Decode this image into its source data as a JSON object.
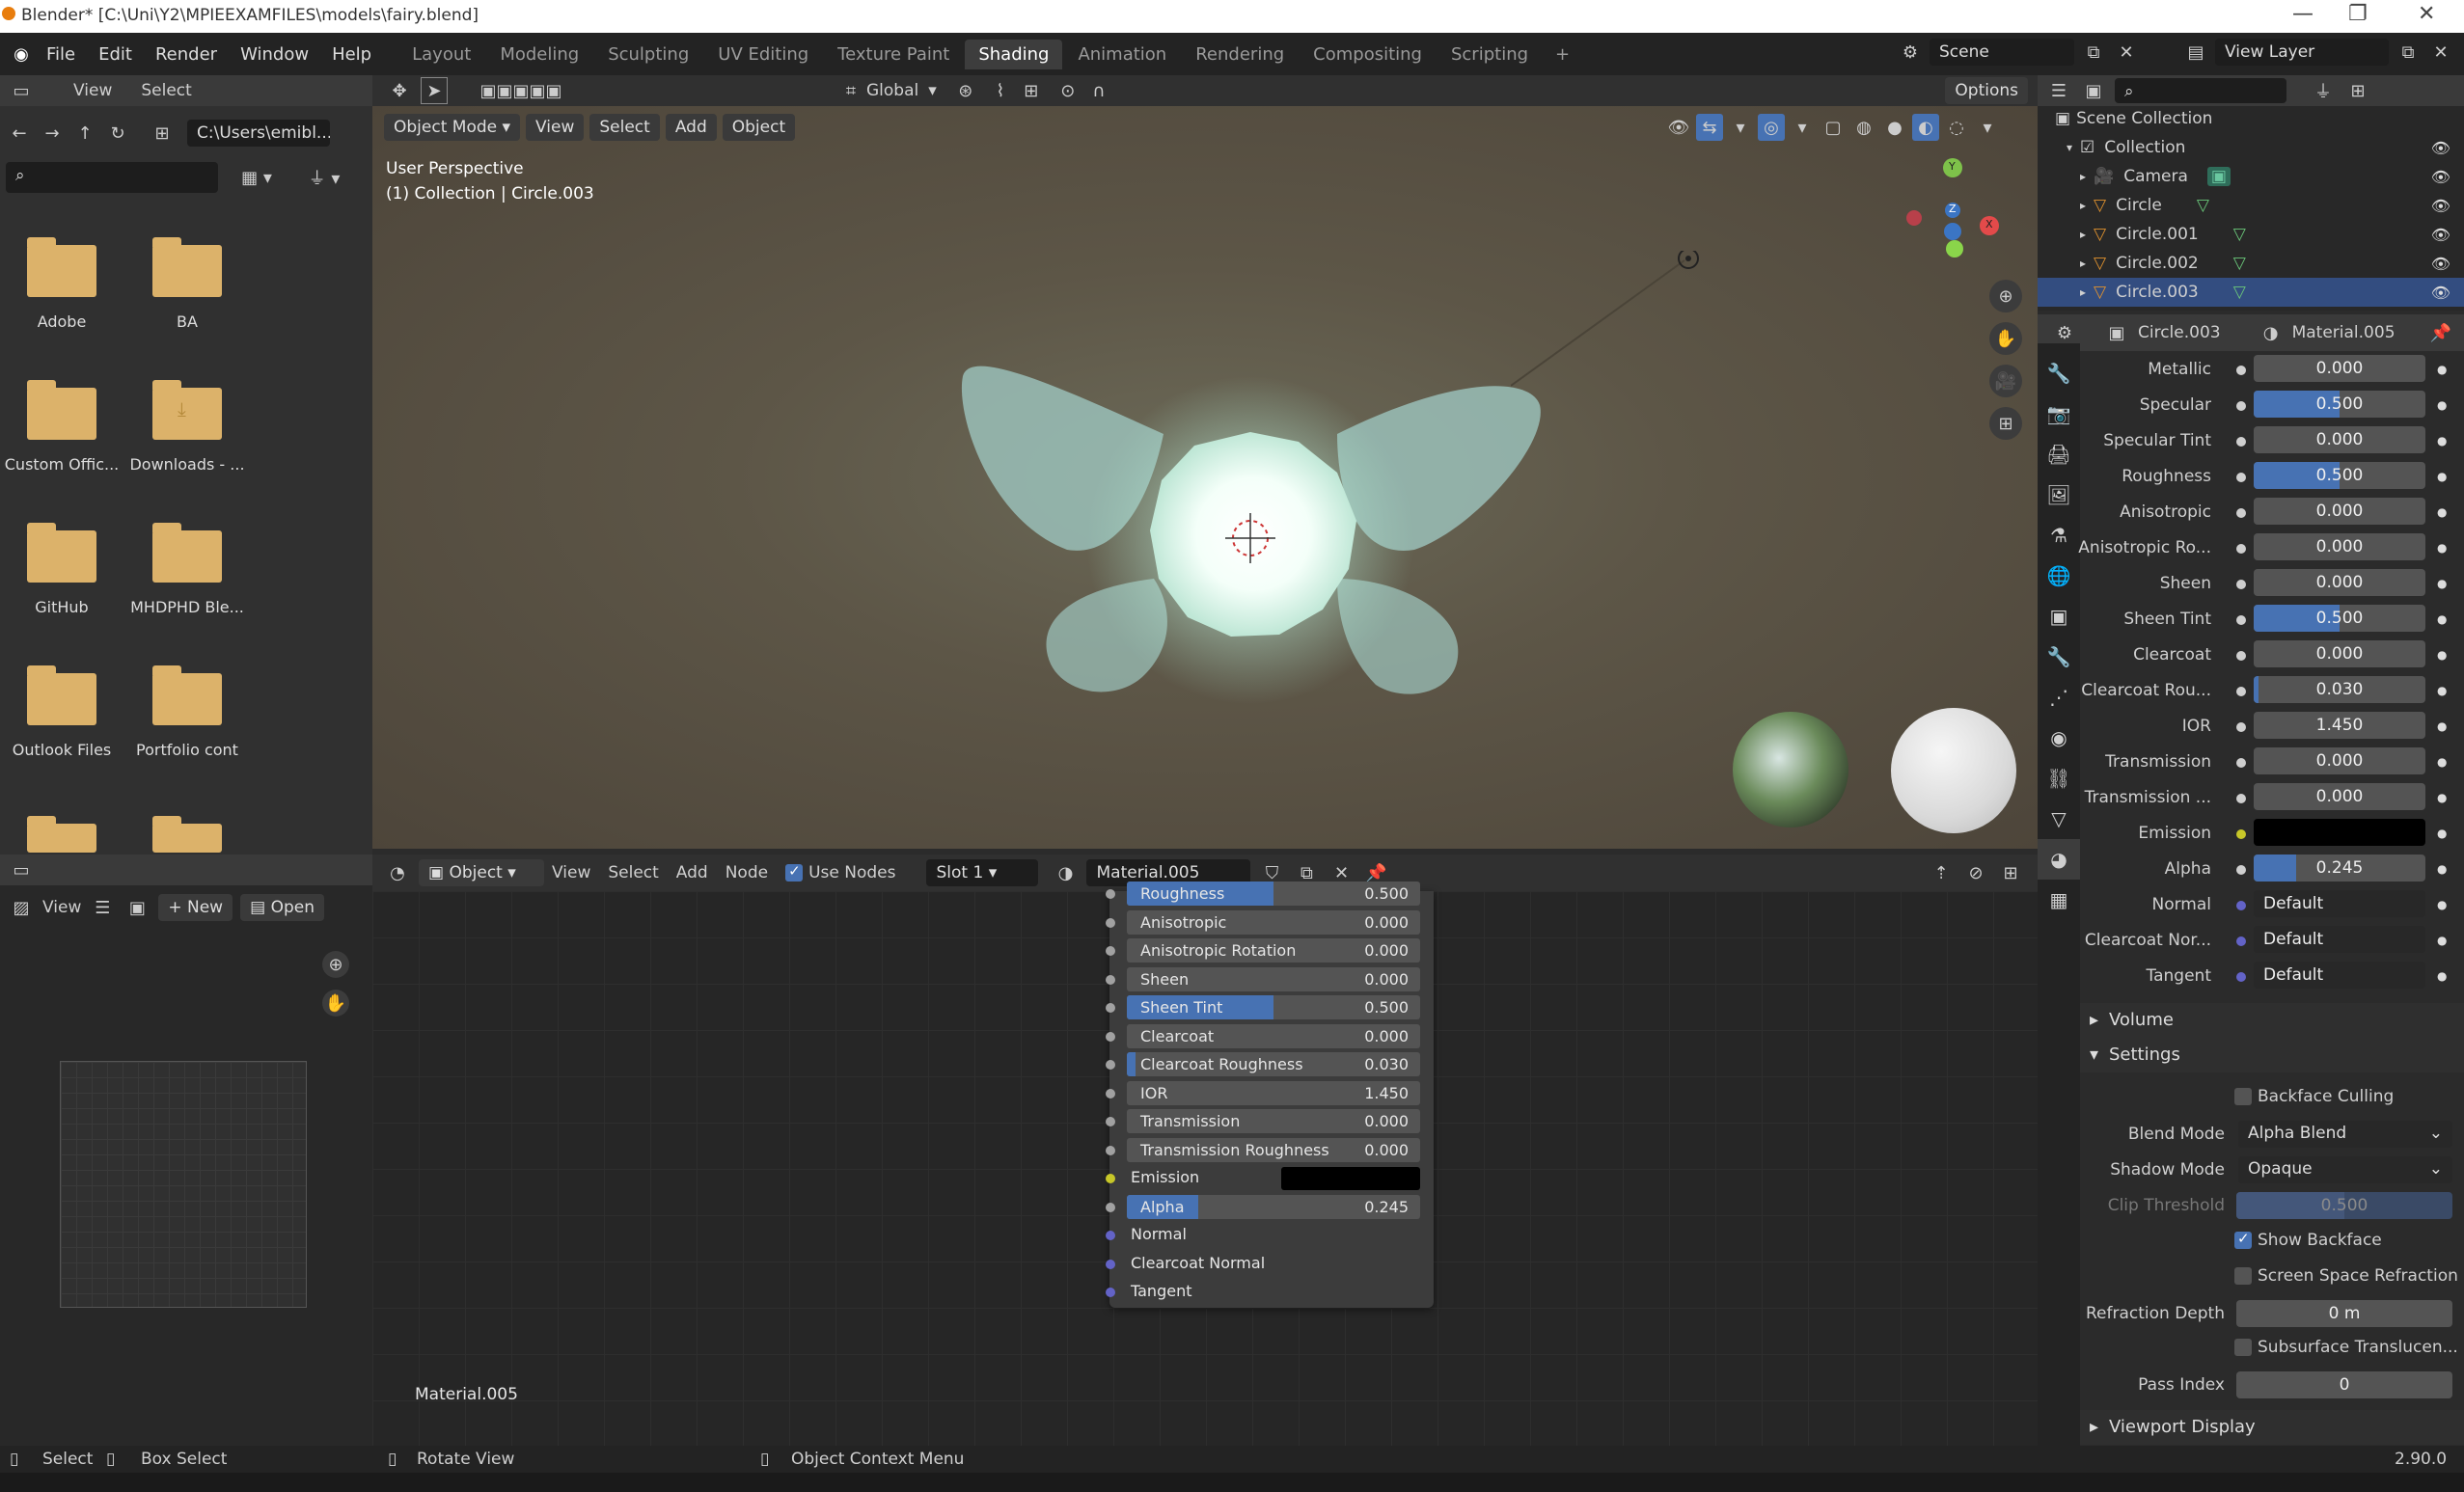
{
  "window": {
    "title": "Blender* [C:\\Uni\\Y2\\MPIEEXAMFILES\\models\\fairy.blend]",
    "min": "—",
    "max": "❐",
    "close": "✕"
  },
  "menu": [
    "File",
    "Edit",
    "Render",
    "Window",
    "Help"
  ],
  "workspaces": [
    {
      "label": "Layout",
      "active": false
    },
    {
      "label": "Modeling",
      "active": false
    },
    {
      "label": "Sculpting",
      "active": false
    },
    {
      "label": "UV Editing",
      "active": false
    },
    {
      "label": "Texture Paint",
      "active": false
    },
    {
      "label": "Shading",
      "active": true
    },
    {
      "label": "Animation",
      "active": false
    },
    {
      "label": "Rendering",
      "active": false
    },
    {
      "label": "Compositing",
      "active": false
    },
    {
      "label": "Scripting",
      "active": false
    }
  ],
  "add_workspace": "+",
  "scene": {
    "label": "Scene",
    "view_layer": "View Layer"
  },
  "filebrowser": {
    "menu_view": "View",
    "menu_select": "Select",
    "path": "C:\\Users\\emibl...",
    "items": [
      {
        "label": "Adobe"
      },
      {
        "label": "BA"
      },
      {
        "label": "Custom Offic..."
      },
      {
        "label": "Downloads - ..."
      },
      {
        "label": "GitHub"
      },
      {
        "label": "MHDPHD Ble..."
      },
      {
        "label": "Outlook Files"
      },
      {
        "label": "Portfolio cont"
      }
    ]
  },
  "image_editor": {
    "view": "View",
    "new": "New",
    "open": "Open"
  },
  "viewport": {
    "mode": "Object Mode",
    "menus": [
      "View",
      "Select",
      "Add",
      "Object"
    ],
    "transform": "Global",
    "options": "Options",
    "info_line1": "User Perspective",
    "info_line2": "(1) Collection | Circle.003",
    "gizmo": {
      "x": "X",
      "y": "Y",
      "z": "Z"
    }
  },
  "node_editor": {
    "type": "Object",
    "menus": [
      "View",
      "Select",
      "Add",
      "Node"
    ],
    "use_nodes": "Use Nodes",
    "slot": "Slot 1",
    "material": "Material.005",
    "footer_label": "Material.005",
    "rows": [
      {
        "label": "Roughness",
        "value": "0.500",
        "fill": 0.5,
        "kind": "slider",
        "socket": "#a1a1a1"
      },
      {
        "label": "Anisotropic",
        "value": "0.000",
        "fill": 0,
        "kind": "slider",
        "socket": "#a1a1a1"
      },
      {
        "label": "Anisotropic Rotation",
        "value": "0.000",
        "fill": 0,
        "kind": "slider",
        "socket": "#a1a1a1"
      },
      {
        "label": "Sheen",
        "value": "0.000",
        "fill": 0,
        "kind": "slider",
        "socket": "#a1a1a1"
      },
      {
        "label": "Sheen Tint",
        "value": "0.500",
        "fill": 0.5,
        "kind": "slider",
        "socket": "#a1a1a1"
      },
      {
        "label": "Clearcoat",
        "value": "0.000",
        "fill": 0,
        "kind": "slider",
        "socket": "#a1a1a1"
      },
      {
        "label": "Clearcoat Roughness",
        "value": "0.030",
        "fill": 0.03,
        "kind": "slider",
        "socket": "#a1a1a1"
      },
      {
        "label": "IOR",
        "value": "1.450",
        "fill": 0,
        "kind": "slider",
        "socket": "#a1a1a1"
      },
      {
        "label": "Transmission",
        "value": "0.000",
        "fill": 0,
        "kind": "slider",
        "socket": "#a1a1a1"
      },
      {
        "label": "Transmission Roughness",
        "value": "0.000",
        "fill": 0,
        "kind": "slider",
        "socket": "#a1a1a1"
      },
      {
        "label": "Emission",
        "value": "",
        "fill": 0,
        "kind": "color",
        "socket": "#c7c729"
      },
      {
        "label": "Alpha",
        "value": "0.245",
        "fill": 0.245,
        "kind": "slider",
        "socket": "#a1a1a1"
      },
      {
        "label": "Normal",
        "value": "",
        "fill": 0,
        "kind": "label",
        "socket": "#6363c7"
      },
      {
        "label": "Clearcoat Normal",
        "value": "",
        "fill": 0,
        "kind": "label",
        "socket": "#6363c7"
      },
      {
        "label": "Tangent",
        "value": "",
        "fill": 0,
        "kind": "label",
        "socket": "#6363c7"
      }
    ]
  },
  "outliner": {
    "title": "Scene Collection",
    "items": [
      {
        "label": "Collection",
        "indent": 1,
        "icon": "collection-icon"
      },
      {
        "label": "Camera",
        "indent": 2,
        "icon": "camera-icon"
      },
      {
        "label": "Circle",
        "indent": 2,
        "icon": "mesh-icon"
      },
      {
        "label": "Circle.001",
        "indent": 2,
        "icon": "mesh-icon"
      },
      {
        "label": "Circle.002",
        "indent": 2,
        "icon": "mesh-icon"
      },
      {
        "label": "Circle.003",
        "indent": 2,
        "icon": "mesh-icon"
      }
    ]
  },
  "properties": {
    "object": "Circle.003",
    "material": "Material.005",
    "rows": [
      {
        "label": "Metallic",
        "value": "0.000",
        "fill": 0,
        "kind": "slider",
        "socket": "#cfcfcf"
      },
      {
        "label": "Specular",
        "value": "0.500",
        "fill": 0.5,
        "kind": "slider",
        "socket": "#cfcfcf"
      },
      {
        "label": "Specular Tint",
        "value": "0.000",
        "fill": 0,
        "kind": "slider",
        "socket": "#cfcfcf"
      },
      {
        "label": "Roughness",
        "value": "0.500",
        "fill": 0.5,
        "kind": "slider",
        "socket": "#cfcfcf"
      },
      {
        "label": "Anisotropic",
        "value": "0.000",
        "fill": 0,
        "kind": "slider",
        "socket": "#cfcfcf"
      },
      {
        "label": "Anisotropic Ro...",
        "value": "0.000",
        "fill": 0,
        "kind": "slider",
        "socket": "#cfcfcf"
      },
      {
        "label": "Sheen",
        "value": "0.000",
        "fill": 0,
        "kind": "slider",
        "socket": "#cfcfcf"
      },
      {
        "label": "Sheen Tint",
        "value": "0.500",
        "fill": 0.5,
        "kind": "slider",
        "socket": "#cfcfcf"
      },
      {
        "label": "Clearcoat",
        "value": "0.000",
        "fill": 0,
        "kind": "slider",
        "socket": "#cfcfcf"
      },
      {
        "label": "Clearcoat Rou...",
        "value": "0.030",
        "fill": 0.03,
        "kind": "slider",
        "socket": "#cfcfcf"
      },
      {
        "label": "IOR",
        "value": "1.450",
        "fill": 0,
        "kind": "slider",
        "socket": "#cfcfcf"
      },
      {
        "label": "Transmission",
        "value": "0.000",
        "fill": 0,
        "kind": "slider",
        "socket": "#cfcfcf"
      },
      {
        "label": "Transmission ...",
        "value": "0.000",
        "fill": 0,
        "kind": "slider",
        "socket": "#cfcfcf"
      },
      {
        "label": "Emission",
        "value": "",
        "fill": 0,
        "kind": "color",
        "socket": "#c7c729"
      },
      {
        "label": "Alpha",
        "value": "0.245",
        "fill": 0.245,
        "kind": "slider",
        "socket": "#cfcfcf"
      },
      {
        "label": "Normal",
        "value": "Default",
        "fill": 0,
        "kind": "text",
        "socket": "#6363c7"
      },
      {
        "label": "Clearcoat Nor...",
        "value": "Default",
        "fill": 0,
        "kind": "text",
        "socket": "#6363c7"
      },
      {
        "label": "Tangent",
        "value": "Default",
        "fill": 0,
        "kind": "text",
        "socket": "#6363c7"
      }
    ],
    "volume": "Volume",
    "settings": "Settings",
    "backface_culling": "Backface Culling",
    "blend_mode_label": "Blend Mode",
    "blend_mode": "Alpha Blend",
    "shadow_mode_label": "Shadow Mode",
    "shadow_mode": "Opaque",
    "clip_threshold_label": "Clip Threshold",
    "clip_threshold": "0.500",
    "show_backface": "Show Backface",
    "screen_space_refraction": "Screen Space Refraction",
    "refraction_depth_label": "Refraction Depth",
    "refraction_depth": "0 m",
    "subsurface": "Subsurface Translucen...",
    "pass_index_label": "Pass Index",
    "pass_index": "0",
    "viewport_display": "Viewport Display"
  },
  "statusbar": {
    "select": "Select",
    "box_select": "Box Select",
    "rotate_view": "Rotate View",
    "context_menu": "Object Context Menu",
    "version": "2.90.0"
  },
  "colors": {
    "accent": "#4772b3",
    "active_tab": "#3d3d3d",
    "folder": "#dcb26a"
  }
}
